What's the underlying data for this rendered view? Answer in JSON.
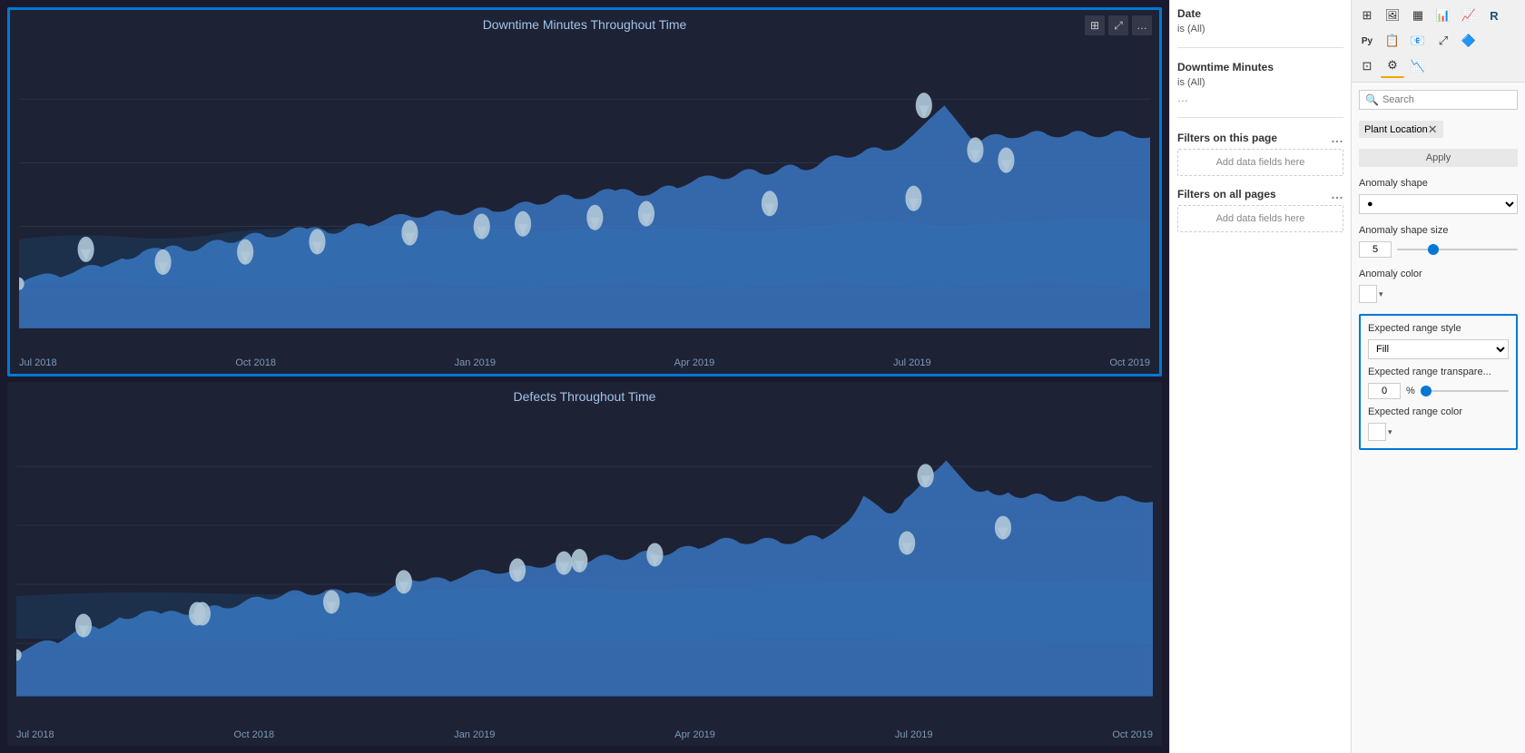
{
  "charts": [
    {
      "id": "chart1",
      "title": "Downtime Minutes Throughout Time",
      "selected": true,
      "xLabels": [
        "Jul 2018",
        "Oct 2018",
        "Jan 2019",
        "Apr 2019",
        "Jul 2019",
        "Oct 2019"
      ]
    },
    {
      "id": "chart2",
      "title": "Defects Throughout Time",
      "selected": false,
      "xLabels": [
        "Jul 2018",
        "Oct 2018",
        "Jan 2019",
        "Apr 2019",
        "Jul 2019",
        "Oct 2019"
      ]
    }
  ],
  "filters": {
    "page_filters_label": "Filters on this page",
    "all_filters_label": "Filters on all pages",
    "add_fields_label": "Add data fields here",
    "filters": [
      {
        "field": "Date",
        "value": "is (All)"
      },
      {
        "field": "Downtime Minutes",
        "value": "is (All)"
      }
    ]
  },
  "right_panel": {
    "search_placeholder": "Search",
    "filter_chip": "Plant Location",
    "apply_label": "Apply",
    "properties": {
      "anomaly_shape_label": "Anomaly shape",
      "anomaly_shape_value": "●",
      "anomaly_shape_size_label": "Anomaly shape size",
      "anomaly_shape_size_value": "5",
      "anomaly_color_label": "Anomaly color",
      "expected_range_style_label": "Expected range style",
      "expected_range_style_value": "Fill",
      "expected_range_transparency_label": "Expected range transpare...",
      "expected_range_transparency_value": "0",
      "expected_range_transparency_pct": "%",
      "expected_range_color_label": "Expected range color"
    }
  },
  "toolbar_icons": [
    [
      "⊞",
      "🖼",
      "▦",
      "📊",
      "📈"
    ],
    [
      "Py",
      "📋",
      "📧",
      "⤢",
      "🔷"
    ],
    [
      "⊡",
      "🔧",
      "📉"
    ]
  ]
}
